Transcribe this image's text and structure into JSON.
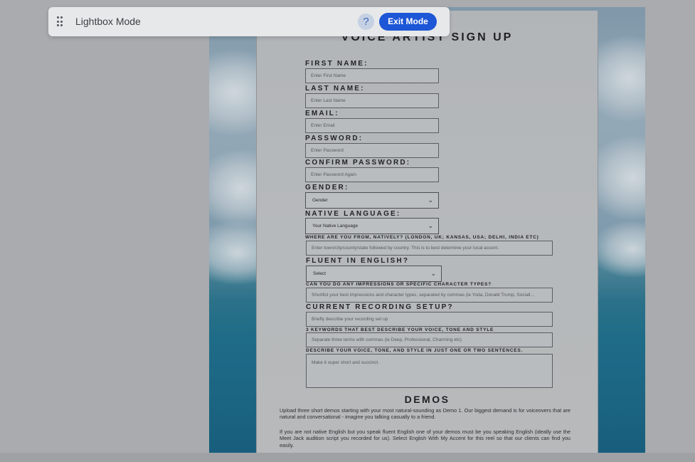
{
  "toolbar": {
    "title": "Lightbox Mode",
    "help_label": "?",
    "exit_label": "Exit Mode"
  },
  "form": {
    "title": "VOICE ARTIST SIGN UP",
    "first_name": {
      "label": "FIRST NAME:",
      "placeholder": "Enter First Name"
    },
    "last_name": {
      "label": "LAST NAME:",
      "placeholder": "Enter Last Name"
    },
    "email": {
      "label": "EMAIL:",
      "placeholder": "Enter Email"
    },
    "password": {
      "label": "PASSWORD:",
      "placeholder": "Enter Password"
    },
    "confirm_password": {
      "label": "CONFIRM PASSWORD:",
      "placeholder": "Enter Password Again"
    },
    "gender": {
      "label": "GENDER:",
      "value": "Gender"
    },
    "native_language": {
      "label": "NATIVE LANGUAGE:",
      "value": "Your Native Language"
    },
    "origin": {
      "label": "WHERE ARE YOU FROM, NATIVELY? (LONDON, UK; KANSAS, USA; DELHI, INDIA ETC)",
      "placeholder": "Enter town/city/county/state followed by country. This is to best determine your local accent."
    },
    "fluent": {
      "label": "FLUENT IN ENGLISH?",
      "value": "Select"
    },
    "impressions": {
      "label": "CAN YOU DO ANY IMPRESSIONS OR SPECIFIC CHARACTER TYPES?",
      "placeholder": "Shortlist your best impressions and character types, separated by commas (ie Yoda, Donald Trump, Sociall..."
    },
    "recording_setup": {
      "label": "CURRENT RECORDING SETUP?",
      "placeholder": "Briefly describe your recording set up"
    },
    "keywords": {
      "label": "3 KEYWORDS THAT BEST DESCRIBE YOUR VOICE, TONE AND STYLE",
      "placeholder": "Separate three terms with commas (ie Deep, Professional, Charming etc)"
    },
    "describe": {
      "label": "DESCRIBE YOUR VOICE, TONE, AND STYLE IN JUST ONE OR TWO SENTENCES.",
      "placeholder": "Make it super short and succinct."
    }
  },
  "demos": {
    "title": "DEMOS",
    "paragraph1": "Upload three short demos starting with your most natural-sounding as Demo 1. Our biggest demand is for voiceovers that are natural and conversational - imagine you talking casually to a friend.",
    "paragraph2": "If you are not native English but you speak fluent English one of your demos must be you speaking English (ideally use the Meet Jack audition script you recorded for us). Select English With My Accent for this reel so that our clients can find you easily."
  }
}
